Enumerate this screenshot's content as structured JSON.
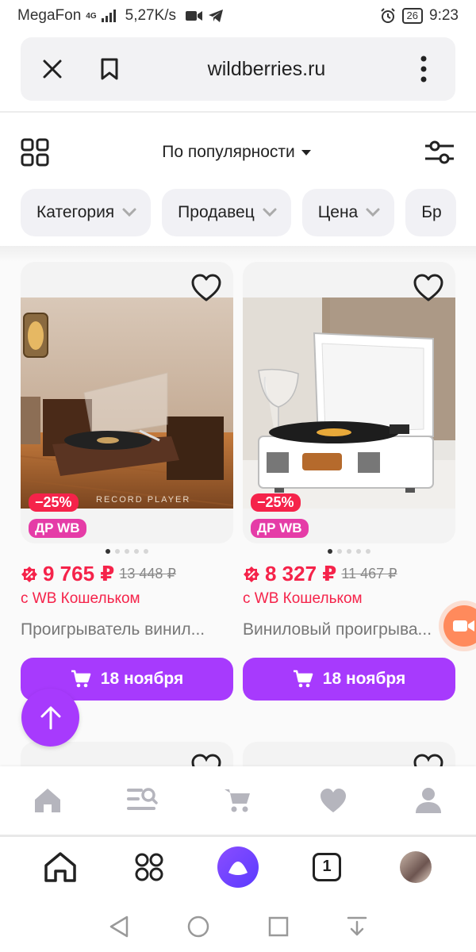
{
  "status_bar": {
    "carrier": "MegaFon",
    "network": "4G",
    "speed": "5,27K/s",
    "battery": "26",
    "time": "9:23"
  },
  "browser": {
    "url": "wildberries.ru",
    "tabs_count": "1"
  },
  "sort": {
    "label": "По популярности"
  },
  "filters": [
    {
      "label": "Категория"
    },
    {
      "label": "Продавец"
    },
    {
      "label": "Цена"
    },
    {
      "label": "Бр"
    }
  ],
  "products": [
    {
      "discount": "−25%",
      "badge": "ДР WB",
      "price": "9 765 ₽",
      "old_price": "13 448 ₽",
      "wallet_note": "с WB Кошельком",
      "name": "Проигрыватель винил...",
      "delivery": "18 ноября",
      "photo_watermark": "RECORD PLAYER",
      "photo_slides": 5,
      "active_slide": 1
    },
    {
      "discount": "−25%",
      "badge": "ДР WB",
      "price": "8 327 ₽",
      "old_price": "11 467 ₽",
      "wallet_note": "с WB Кошельком",
      "name": "Виниловый проигрыва...",
      "delivery": "18 ноября",
      "photo_slides": 5,
      "active_slide": 1
    }
  ],
  "colors": {
    "accent": "#a73afd",
    "price_red": "#f5234a",
    "badge_pink": "#e53ca7",
    "nav_icon_gray": "#b5b5bd"
  },
  "icons": {
    "site_nav": [
      "home-icon",
      "catalog-search-icon",
      "cart-icon",
      "favorites-icon",
      "profile-icon"
    ],
    "browser_nav": [
      "home-icon",
      "services-grid-icon",
      "alice-icon",
      "tabs-icon",
      "avatar"
    ],
    "system_nav": [
      "back-icon",
      "home-circle-icon",
      "recents-icon",
      "notifications-down-icon"
    ]
  }
}
